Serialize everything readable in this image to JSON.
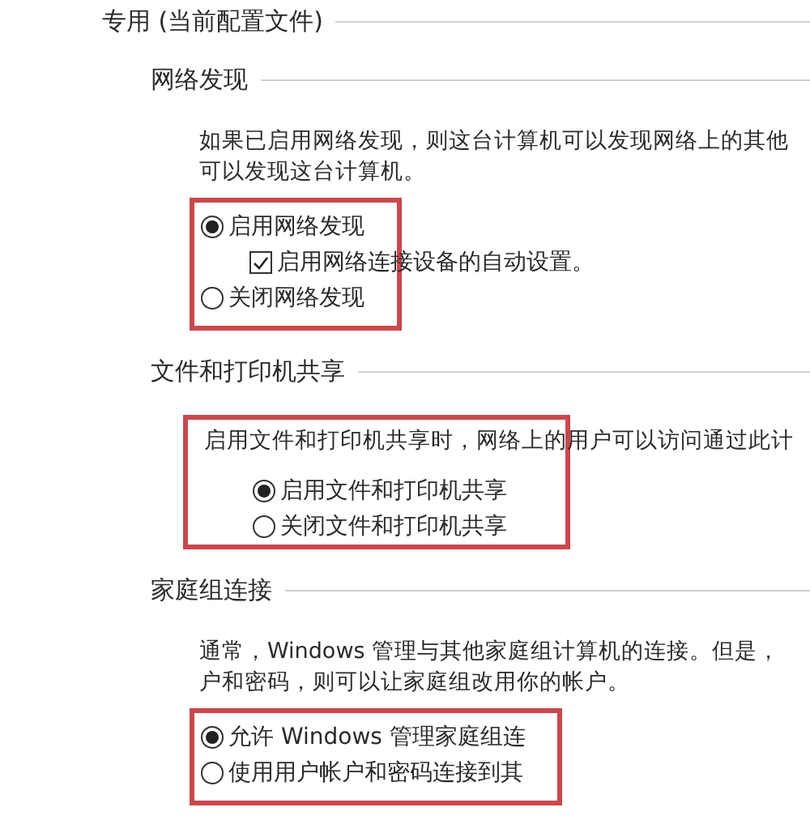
{
  "profile": {
    "title": "专用 (当前配置文件)"
  },
  "sections": [
    {
      "title": "网络发现",
      "description": [
        "如果已启用网络发现，则这台计算机可以发现网络上的其他",
        "可以发现这台计算机。"
      ],
      "description_highlighted": false,
      "options": [
        {
          "kind": "radio",
          "label": "启用网络发现",
          "selected": true
        },
        {
          "kind": "checkbox",
          "label": "启用网络连接设备的自动设置。",
          "checked": true
        },
        {
          "kind": "radio",
          "label": "关闭网络发现",
          "selected": false
        }
      ]
    },
    {
      "title": "文件和打印机共享",
      "description": [
        "启用文件和打印机共享时，网络上的用户可以访问通过此计"
      ],
      "description_highlighted": true,
      "options": [
        {
          "kind": "radio",
          "label": "启用文件和打印机共享",
          "selected": true
        },
        {
          "kind": "radio",
          "label": "关闭文件和打印机共享",
          "selected": false
        }
      ]
    },
    {
      "title": "家庭组连接",
      "description": [
        "通常，Windows 管理与其他家庭组计算机的连接。但是，",
        "户和密码，则可以让家庭组改用你的帐户。"
      ],
      "description_highlighted": false,
      "options": [
        {
          "kind": "radio",
          "label": "允许 Windows 管理家庭组连",
          "selected": true
        },
        {
          "kind": "radio",
          "label": "使用用户帐户和密码连接到其",
          "selected": false
        }
      ]
    }
  ]
}
